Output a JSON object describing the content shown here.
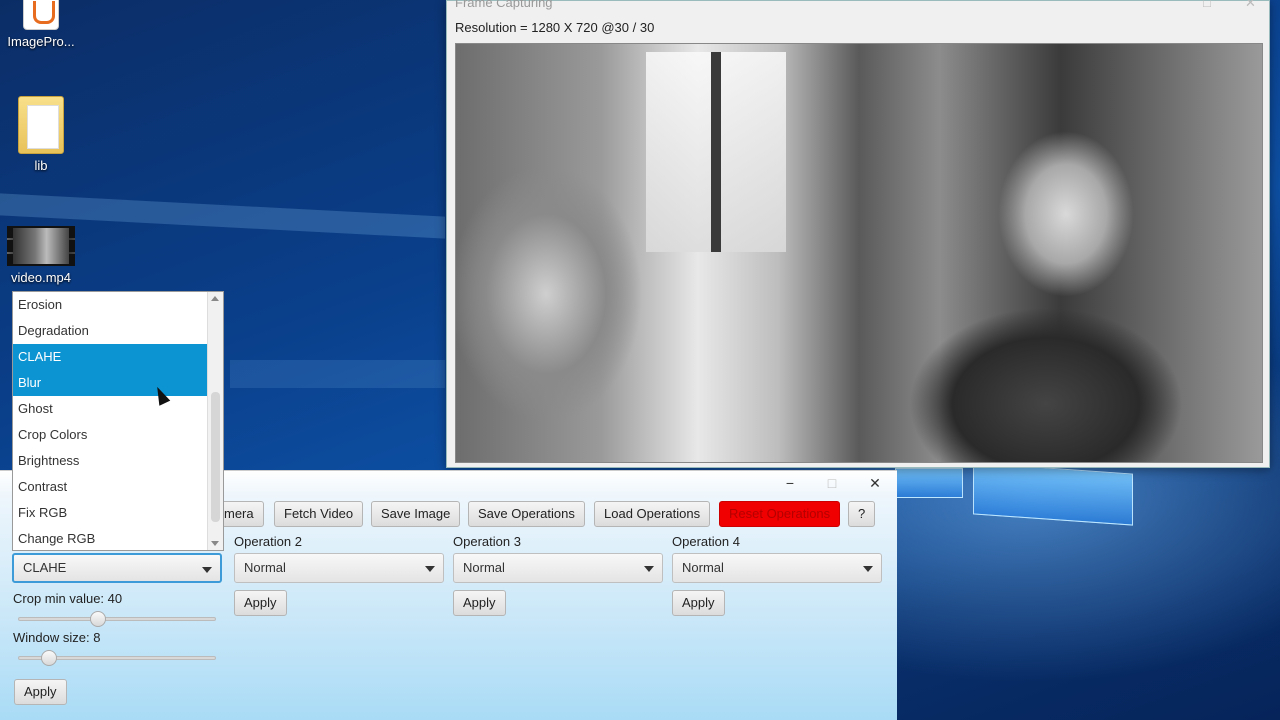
{
  "desktop": {
    "icons": [
      {
        "label": "ImagePro..."
      },
      {
        "label": "lib"
      },
      {
        "label": "video.mp4"
      }
    ]
  },
  "frame_window": {
    "title": "Frame Capturing",
    "resolution_text": "Resolution = 1280 X 720 @30 / 30"
  },
  "controls_window": {
    "window_buttons": {
      "minimize": "−",
      "maximize": "□",
      "close": "✕"
    },
    "toolbar": {
      "camera_label": "mera",
      "fetch_video_label": "Fetch Video",
      "save_image_label": "Save Image",
      "save_operations_label": "Save Operations",
      "load_operations_label": "Load Operations",
      "reset_operations_label": "Reset Operations",
      "help_label": "?"
    },
    "operation1": {
      "selected": "CLAHE",
      "crop_min_label": "Crop min value: 40",
      "crop_min_value": 40,
      "window_size_label": "Window size: 8",
      "window_size_value": 8,
      "apply_label": "Apply"
    },
    "operation2": {
      "label": "Operation 2",
      "selected": "Normal",
      "apply_label": "Apply"
    },
    "operation3": {
      "label": "Operation 3",
      "selected": "Normal",
      "apply_label": "Apply"
    },
    "operation4": {
      "label": "Operation 4",
      "selected": "Normal",
      "apply_label": "Apply"
    },
    "dropdown": {
      "items": [
        "Erosion",
        "Degradation",
        "CLAHE",
        "Blur",
        "Ghost",
        "Crop Colors",
        "Brightness",
        "Contrast",
        "Fix RGB",
        "Change RGB"
      ],
      "highlighted": [
        "CLAHE",
        "Blur"
      ]
    }
  },
  "colors": {
    "selection": "#0c93d2",
    "reset_button": "#f00000",
    "focus_border": "#3d9bd8"
  }
}
